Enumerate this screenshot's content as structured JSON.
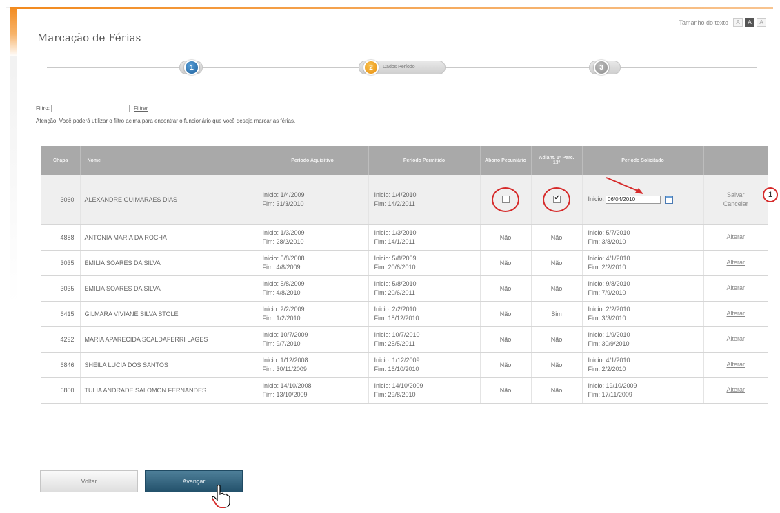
{
  "page": {
    "title": "Marcação de Férias"
  },
  "text_size": {
    "label": "Tamanho do texto",
    "buttons": [
      "A",
      "A",
      "A"
    ]
  },
  "steps": [
    {
      "number": "1",
      "label": ""
    },
    {
      "number": "2",
      "label": "Dados Período"
    },
    {
      "number": "3",
      "label": ""
    }
  ],
  "filter": {
    "label": "Filtro:",
    "value": "",
    "link": "Filtrar",
    "notice": "Atenção: Você poderá utilizar o filtro acima para encontrar o funcionário que você deseja marcar as férias."
  },
  "table": {
    "headers": [
      "Chapa",
      "Nome",
      "Período Aquisitivo",
      "Período Permitido",
      "Abono Pecuniário",
      "Adiant. 1ª Parc. 13º",
      "Período Solicitado",
      ""
    ],
    "editing_row": {
      "chapa": "3060",
      "nome": "ALEXANDRE GUIMARAES DIAS",
      "aquisitivo_inicio": "Inicio: 1/4/2009",
      "aquisitivo_fim": "Fim: 31/3/2010",
      "permitido_inicio": "Inicio: 1/4/2010",
      "permitido_fim": "Fim: 14/2/2011",
      "abono_checked": false,
      "adiant_checked": true,
      "solicitado_label": "Inicio:",
      "solicitado_value": "06/04/2010",
      "salvar": "Salvar",
      "cancelar": "Cancelar"
    },
    "rows": [
      {
        "chapa": "4888",
        "nome": "ANTONIA MARIA DA ROCHA",
        "aq_i": "Inicio: 1/3/2009",
        "aq_f": "Fim: 28/2/2010",
        "pe_i": "Inicio: 1/3/2010",
        "pe_f": "Fim: 14/1/2011",
        "abono": "Não",
        "adiant": "Não",
        "so_i": "Inicio: 5/7/2010",
        "so_f": "Fim: 3/8/2010",
        "action": "Alterar"
      },
      {
        "chapa": "3035",
        "nome": "EMILIA SOARES DA SILVA",
        "aq_i": "Inicio: 5/8/2008",
        "aq_f": "Fim: 4/8/2009",
        "pe_i": "Inicio: 5/8/2009",
        "pe_f": "Fim: 20/6/2010",
        "abono": "Não",
        "adiant": "Não",
        "so_i": "Inicio: 4/1/2010",
        "so_f": "Fim: 2/2/2010",
        "action": "Alterar"
      },
      {
        "chapa": "3035",
        "nome": "EMILIA SOARES DA SILVA",
        "aq_i": "Inicio: 5/8/2009",
        "aq_f": "Fim: 4/8/2010",
        "pe_i": "Inicio: 5/8/2010",
        "pe_f": "Fim: 20/6/2011",
        "abono": "Não",
        "adiant": "Não",
        "so_i": "Inicio: 9/8/2010",
        "so_f": "Fim: 7/9/2010",
        "action": "Alterar"
      },
      {
        "chapa": "6415",
        "nome": "GILMARA VIVIANE SILVA STOLE",
        "aq_i": "Inicio: 2/2/2009",
        "aq_f": "Fim: 1/2/2010",
        "pe_i": "Inicio: 2/2/2010",
        "pe_f": "Fim: 18/12/2010",
        "abono": "Não",
        "adiant": "Sim",
        "so_i": "Inicio: 2/2/2010",
        "so_f": "Fim: 3/3/2010",
        "action": "Alterar"
      },
      {
        "chapa": "4292",
        "nome": "MARIA APARECIDA SCALDAFERRI LAGES",
        "aq_i": "Inicio: 10/7/2009",
        "aq_f": "Fim: 9/7/2010",
        "pe_i": "Inicio: 10/7/2010",
        "pe_f": "Fim: 25/5/2011",
        "abono": "Não",
        "adiant": "Não",
        "so_i": "Inicio: 1/9/2010",
        "so_f": "Fim: 30/9/2010",
        "action": "Alterar"
      },
      {
        "chapa": "6846",
        "nome": "SHEILA LUCIA DOS SANTOS",
        "aq_i": "Inicio: 1/12/2008",
        "aq_f": "Fim: 30/11/2009",
        "pe_i": "Inicio: 1/12/2009",
        "pe_f": "Fim: 16/10/2010",
        "abono": "Não",
        "adiant": "Não",
        "so_i": "Inicio: 4/1/2010",
        "so_f": "Fim: 2/2/2010",
        "action": "Alterar"
      },
      {
        "chapa": "6800",
        "nome": "TULIA ANDRADE SALOMON FERNANDES",
        "aq_i": "Inicio: 14/10/2008",
        "aq_f": "Fim: 13/10/2009",
        "pe_i": "Inicio: 14/10/2009",
        "pe_f": "Fim: 29/8/2010",
        "abono": "Não",
        "adiant": "Não",
        "so_i": "Inicio: 19/10/2009",
        "so_f": "Fim: 17/11/2009",
        "action": "Alterar"
      }
    ]
  },
  "annotation": {
    "number": "1",
    "color": "#d62a2a"
  },
  "buttons": {
    "back": "Voltar",
    "next": "Avançar"
  },
  "colors": {
    "accent": "#f28a1e",
    "header_bg": "#a9a9a9",
    "primary_button": "#2f5f7a"
  }
}
